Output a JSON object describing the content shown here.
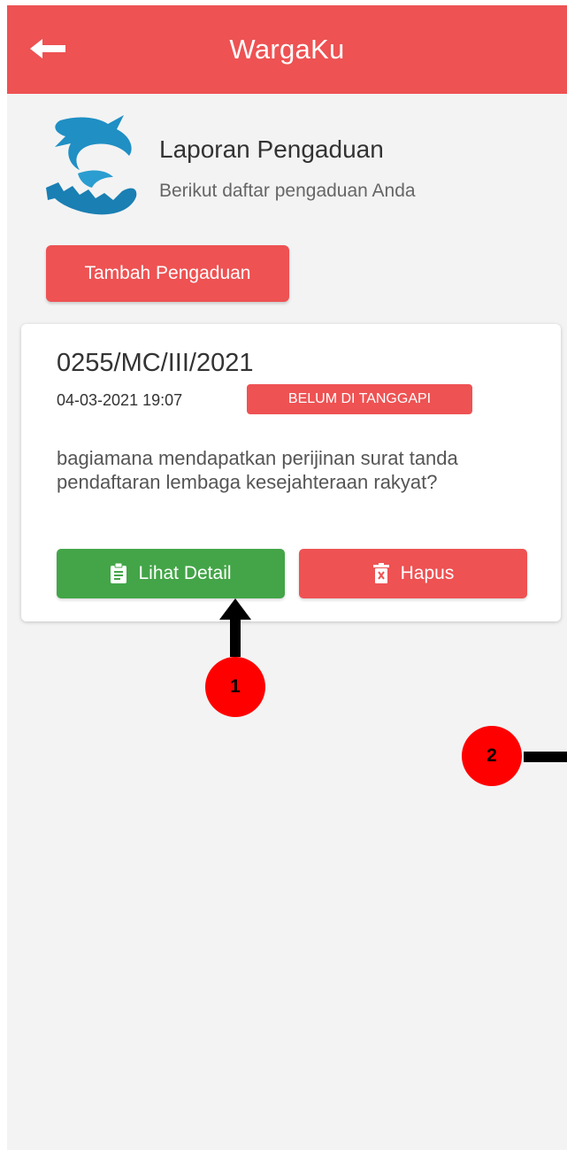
{
  "appbar": {
    "title": "WargaKu"
  },
  "header": {
    "title": "Laporan Pengaduan",
    "subtitle": "Berikut daftar pengaduan Anda"
  },
  "add_button": {
    "label": "Tambah Pengaduan"
  },
  "complaint": {
    "number": "0255/MC/III/2021",
    "datetime": "04-03-2021 19:07",
    "status": "BELUM DI TANGGAPI",
    "description": "bagiamana mendapatkan perijinan surat tanda pendaftaran lembaga kesejahteraan rakyat?",
    "detail_label": "Lihat Detail",
    "delete_label": "Hapus"
  },
  "annotations": [
    {
      "label": "1"
    },
    {
      "label": "2"
    }
  ],
  "colors": {
    "accent_red": "#ee5253",
    "success_green": "#43a547",
    "background": "#f3f3f3",
    "marker_red": "#ff0000"
  },
  "icons": [
    "back-arrow-icon",
    "app-logo",
    "clipboard-icon",
    "trash-icon"
  ]
}
